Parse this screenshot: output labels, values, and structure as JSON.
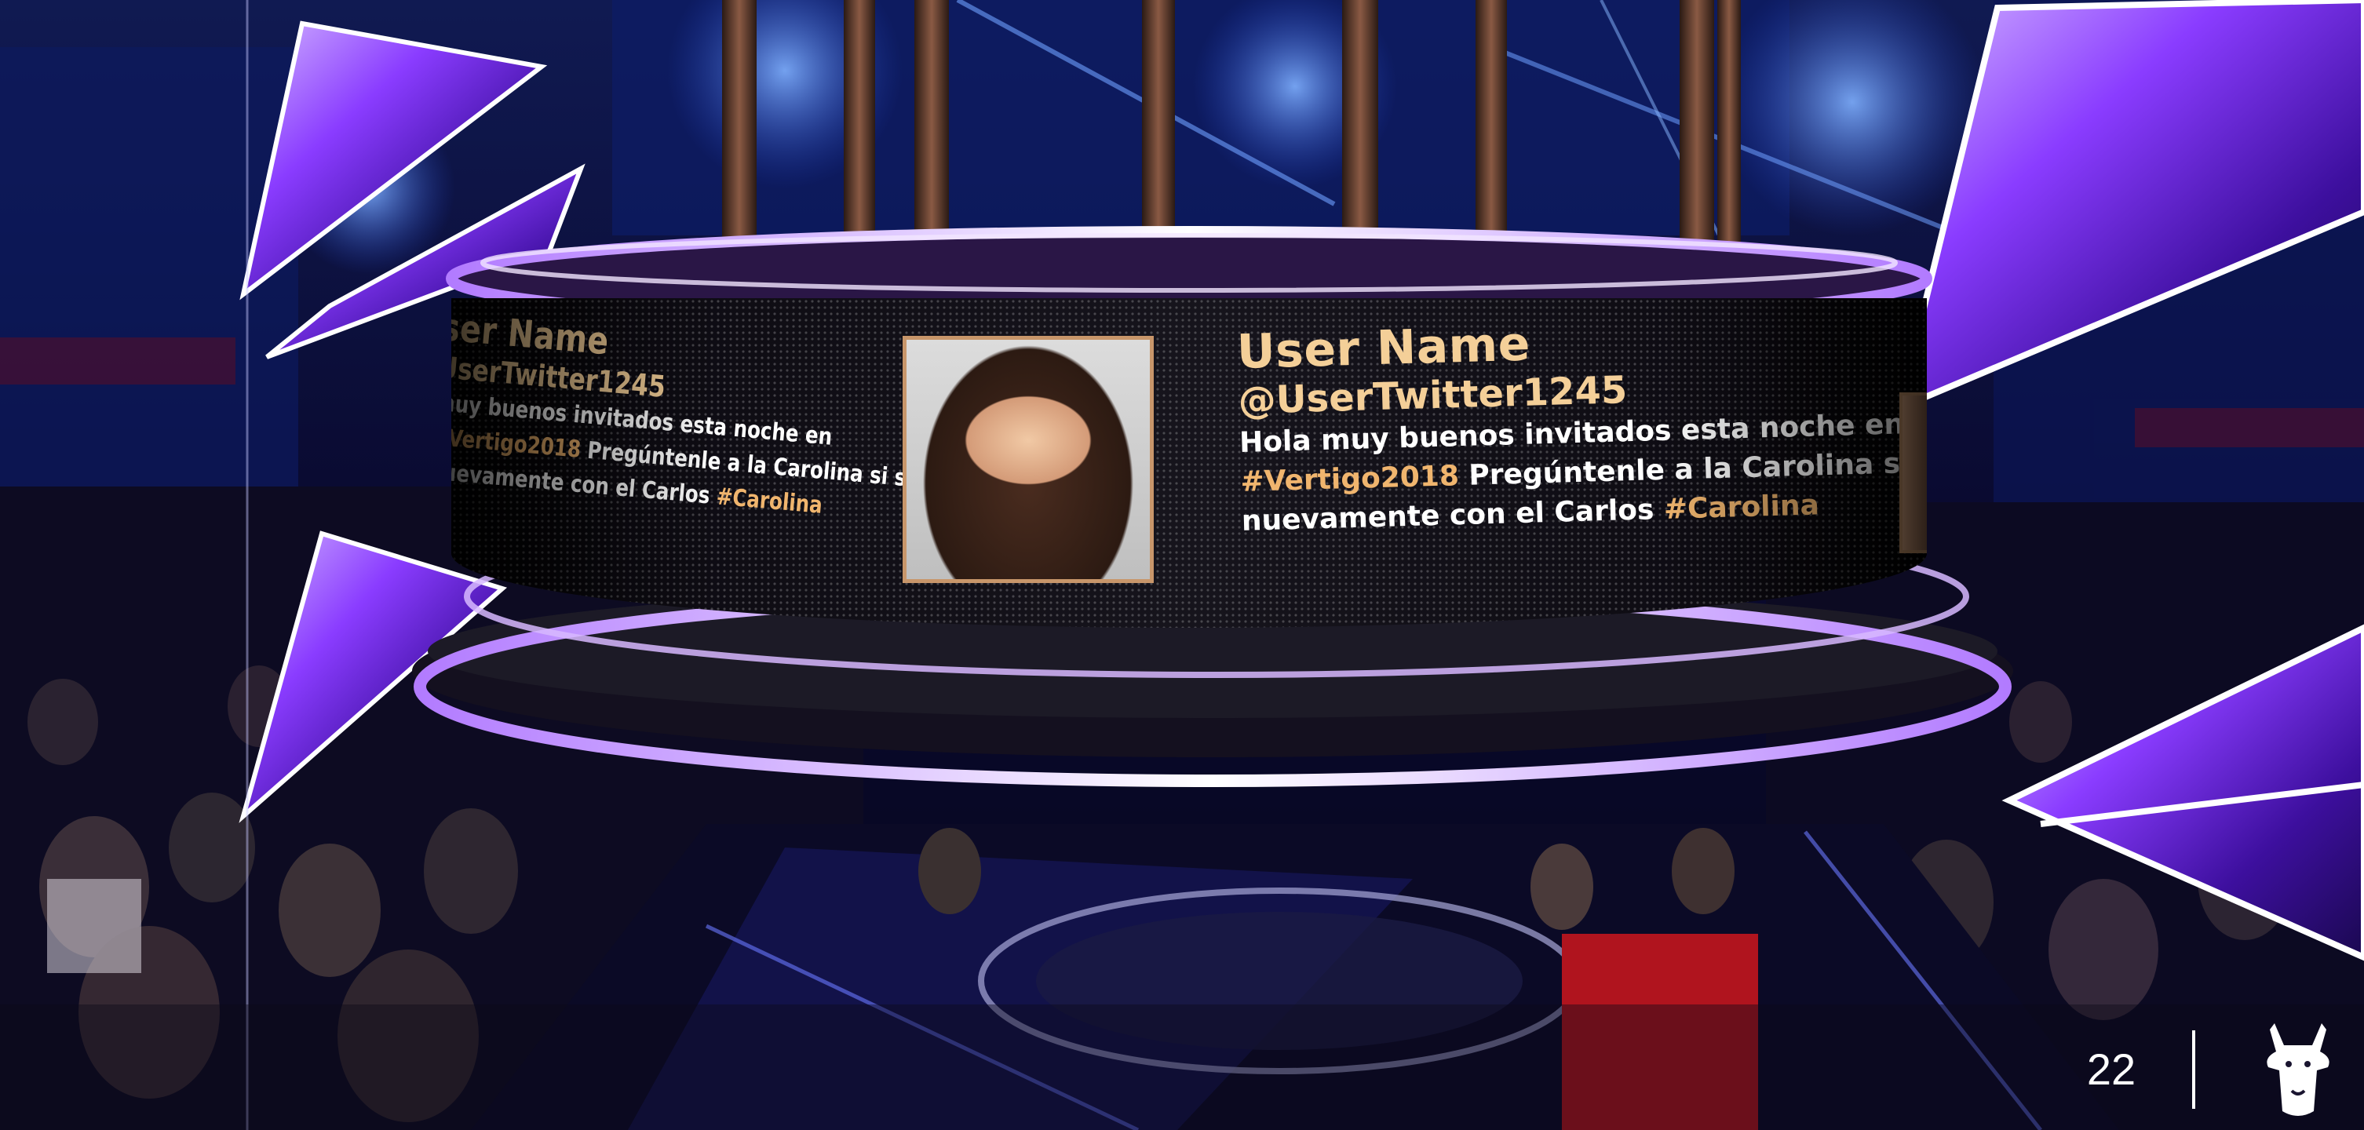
{
  "broadcast": {
    "ticker_main": {
      "user_name": "User Name",
      "handle": "@UserTwitter1245",
      "message_line_1": "Hola muy  buenos invitados esta noche en",
      "message_line_2_hashtag": "#Vertigo2018",
      "message_line_2_text": " Pregúntenle a la Carolina si saldría",
      "message_line_3_text": "nuevamente con el Carlos ",
      "message_line_3_hashtag": "#Carolina"
    },
    "ticker_left_partial": {
      "user_name": "ser Name",
      "handle": "UserTwitter1245",
      "message_line_1": "muy  buenos invitados esta noche en",
      "message_line_2_hashtag": "#Vertigo2018",
      "message_line_2_text": " Pregúntenle a la Carolina si saldría",
      "message_line_3_text": "nuevamente con el Carlos ",
      "message_line_3_hashtag": "#Carolina"
    }
  },
  "footer": {
    "page_number": "22",
    "logo_icon": "llama-head-icon"
  },
  "colors": {
    "accent_purple": "#9b5cff",
    "ring_glow": "#e9d7ff",
    "name_gold": "#f4cf98",
    "hashtag_orange": "#f0b56e"
  }
}
